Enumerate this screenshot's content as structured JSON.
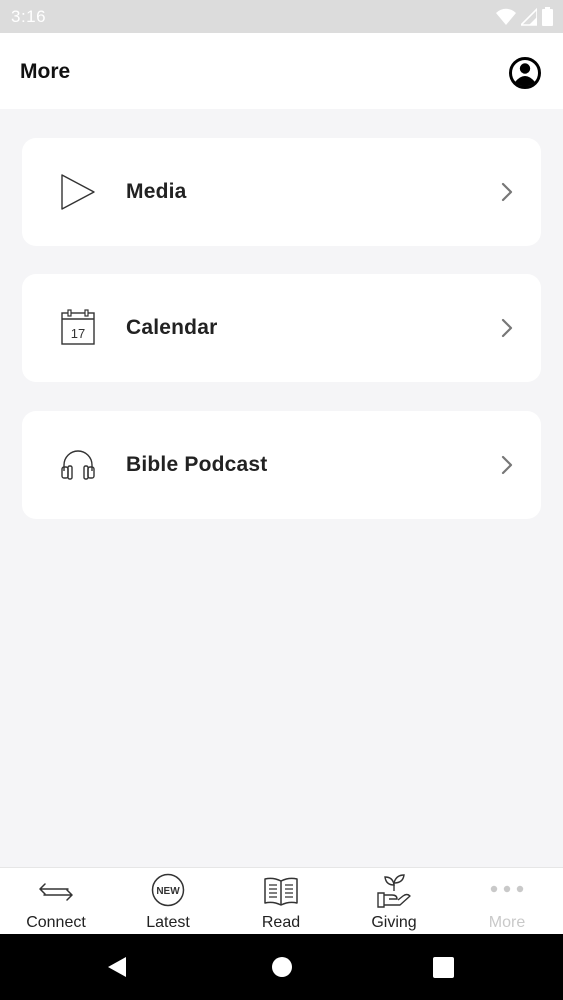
{
  "status_bar": {
    "time": "3:16"
  },
  "header": {
    "title": "More"
  },
  "menu": [
    {
      "label": "Media",
      "icon": "play-icon"
    },
    {
      "label": "Calendar",
      "icon": "calendar-icon",
      "icon_text": "17"
    },
    {
      "label": "Bible Podcast",
      "icon": "headphones-icon"
    }
  ],
  "tabs": [
    {
      "label": "Connect",
      "icon": "arrows-exchange-icon"
    },
    {
      "label": "Latest",
      "icon": "new-badge-icon",
      "icon_text": "NEW"
    },
    {
      "label": "Read",
      "icon": "open-book-icon"
    },
    {
      "label": "Giving",
      "icon": "giving-hand-icon"
    },
    {
      "label": "More",
      "icon": "more-dots-icon",
      "active": true
    }
  ],
  "colors": {
    "active_tab": "#c9c9c9",
    "background": "#f5f5f7",
    "status_bar": "#dcdcdc"
  }
}
